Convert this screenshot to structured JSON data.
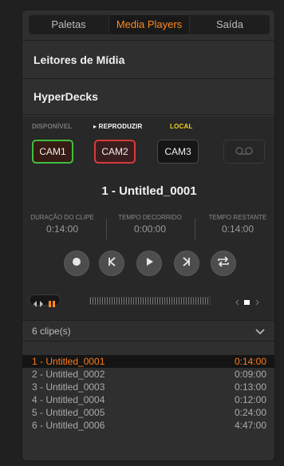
{
  "tabs": [
    {
      "label": "Paletas",
      "active": false
    },
    {
      "label": "Media Players",
      "active": true
    },
    {
      "label": "Saída",
      "active": false
    }
  ],
  "media_players": {
    "title": "Leitores de Mídia"
  },
  "hyperdecks": {
    "title": "HyperDecks",
    "status": {
      "available": "DISPONÍVEL",
      "play": "▸ REPRODUZIR",
      "local": "LOCAL"
    },
    "cams": [
      "CAM1",
      "CAM2",
      "CAM3"
    ],
    "current_clip": "1 - Untitled_0001",
    "times": {
      "duration_label": "DURAÇÃO DO CLIPE",
      "duration": "0:14:00",
      "elapsed_label": "TEMPO DECORRIDO",
      "elapsed": "0:00:00",
      "remaining_label": "TEMPO RESTANTE",
      "remaining": "0:14:00"
    }
  },
  "clips": {
    "count_label": "6 clipe(s)",
    "items": [
      {
        "name": "1 - Untitled_0001",
        "time": "0:14:00",
        "selected": true
      },
      {
        "name": "2 - Untitled_0002",
        "time": "0:09:00",
        "selected": false
      },
      {
        "name": "3 - Untitled_0003",
        "time": "0:13:00",
        "selected": false
      },
      {
        "name": "4 - Untitled_0004",
        "time": "0:12:00",
        "selected": false
      },
      {
        "name": "5 - Untitled_0005",
        "time": "0:24:00",
        "selected": false
      },
      {
        "name": "6 - Untitled_0006",
        "time": "4:47:00",
        "selected": false
      }
    ]
  },
  "colors": {
    "accent": "#ff8a1f",
    "cam1_border": "#3fbf3f",
    "cam2_border": "#d73a3a",
    "local": "#f2d21f"
  },
  "icons": [
    "record-icon",
    "skip-back-icon",
    "play-icon",
    "skip-forward-icon",
    "loop-icon",
    "tape-icon",
    "chevron-down-icon"
  ]
}
